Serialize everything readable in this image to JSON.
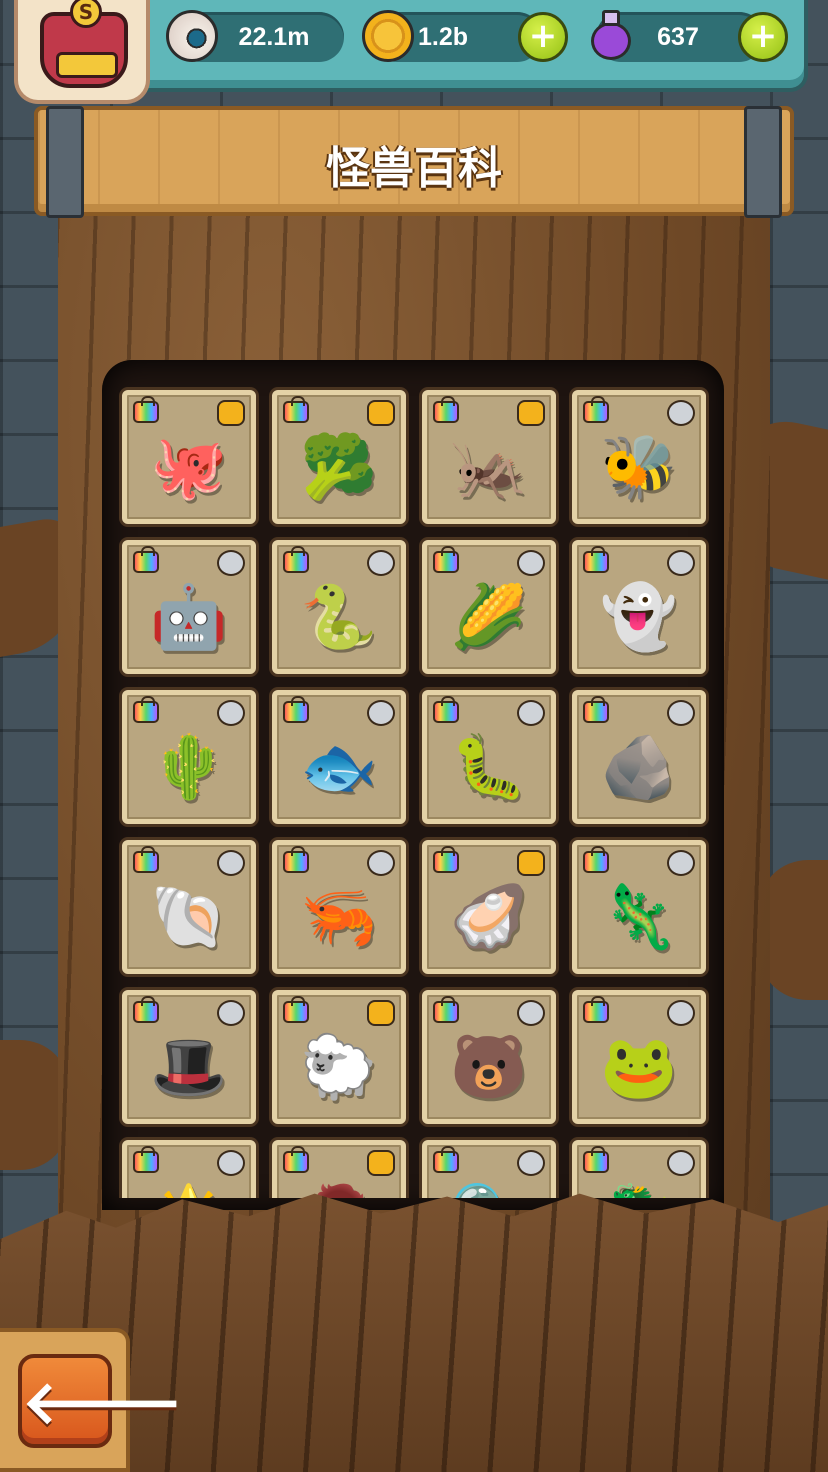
{
  "header": {
    "avatar_letter": "S",
    "eyes_value": "22.1m",
    "coins_value": "1.2b",
    "potions_value": "637",
    "plus_symbol": "+"
  },
  "title": "怪兽百科",
  "back_arrow": "🡐",
  "cards": [
    {
      "creature": "🐙",
      "badge": "gold"
    },
    {
      "creature": "🥦",
      "badge": "gold"
    },
    {
      "creature": "🦗",
      "badge": "gold"
    },
    {
      "creature": "🐝",
      "badge": "silver"
    },
    {
      "creature": "🤖",
      "badge": "silver"
    },
    {
      "creature": "🐍",
      "badge": "silver"
    },
    {
      "creature": "🌽",
      "badge": "silver"
    },
    {
      "creature": "👻",
      "badge": "silver"
    },
    {
      "creature": "🌵",
      "badge": "silver"
    },
    {
      "creature": "🐟",
      "badge": "silver"
    },
    {
      "creature": "🐛",
      "badge": "silver"
    },
    {
      "creature": "🪨",
      "badge": "silver"
    },
    {
      "creature": "🐚",
      "badge": "silver"
    },
    {
      "creature": "🦐",
      "badge": "silver"
    },
    {
      "creature": "🦪",
      "badge": "gold"
    },
    {
      "creature": "🦎",
      "badge": "silver"
    },
    {
      "creature": "🎩",
      "badge": "silver"
    },
    {
      "creature": "🐑",
      "badge": "gold"
    },
    {
      "creature": "🐻",
      "badge": "silver"
    },
    {
      "creature": "🐸",
      "badge": "silver"
    },
    {
      "creature": "🌟",
      "badge": "silver"
    },
    {
      "creature": "🧟",
      "badge": "gold"
    },
    {
      "creature": "🫧",
      "badge": "silver"
    },
    {
      "creature": "🐉",
      "badge": "silver"
    }
  ]
}
